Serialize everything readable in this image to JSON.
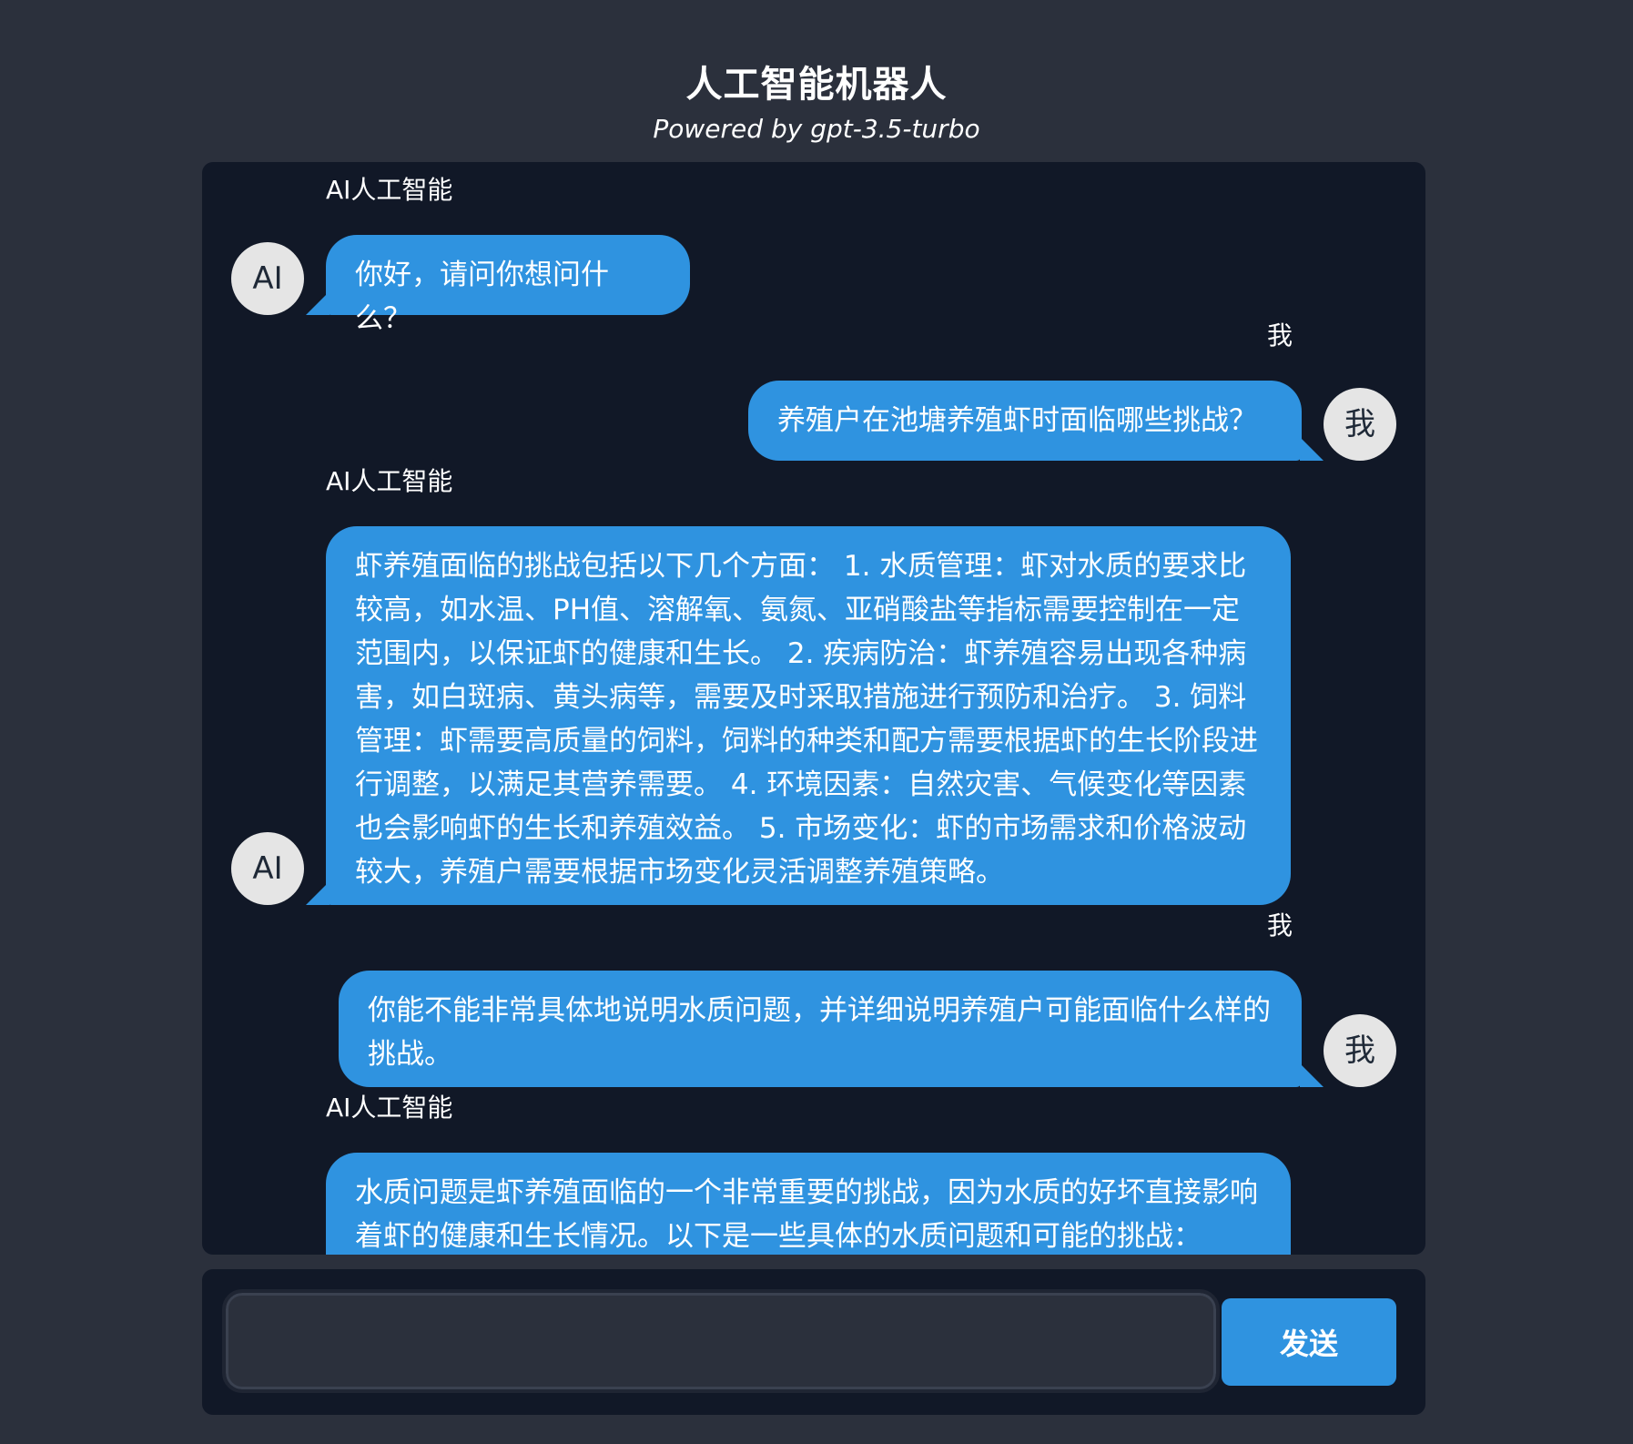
{
  "header": {
    "title": "人工智能机器人",
    "subtitle": "Powered by gpt-3.5-turbo"
  },
  "messages": [
    {
      "role": "ai",
      "name": "AI人工智能",
      "avatar": "AI",
      "text": "你好，请问你想问什么？"
    },
    {
      "role": "me",
      "name": "我",
      "avatar": "我",
      "text": "养殖户在池塘养殖虾时面临哪些挑战？"
    },
    {
      "role": "ai",
      "name": "AI人工智能",
      "avatar": "AI",
      "text": "虾养殖面临的挑战包括以下几个方面： 1. 水质管理：虾对水质的要求比较高，如水温、PH值、溶解氧、氨氮、亚硝酸盐等指标需要控制在一定范围内，以保证虾的健康和生长。 2. 疾病防治：虾养殖容易出现各种病害，如白斑病、黄头病等，需要及时采取措施进行预防和治疗。 3. 饲料管理：虾需要高质量的饲料，饲料的种类和配方需要根据虾的生长阶段进行调整，以满足其营养需要。 4. 环境因素：自然灾害、气候变化等因素也会影响虾的生长和养殖效益。 5. 市场变化：虾的市场需求和价格波动较大，养殖户需要根据市场变化灵活调整养殖策略。"
    },
    {
      "role": "me",
      "name": "我",
      "avatar": "我",
      "text": "你能不能非常具体地说明水质问题，并详细说明养殖户可能面临什么样的挑战。"
    },
    {
      "role": "ai",
      "name": "AI人工智能",
      "avatar": "AI",
      "text": "水质问题是虾养殖面临的一个非常重要的挑战，因为水质的好坏直接影响着虾的健康和生长情况。以下是一些具体的水质问题和可能的挑战："
    }
  ],
  "input": {
    "value": "",
    "placeholder": ""
  },
  "send_button": {
    "label": "发送"
  },
  "colors": {
    "page_background": "#2b303c",
    "chat_panel": "#111827",
    "bubble": "#2f93e0",
    "avatar": "#e5e5e5"
  }
}
